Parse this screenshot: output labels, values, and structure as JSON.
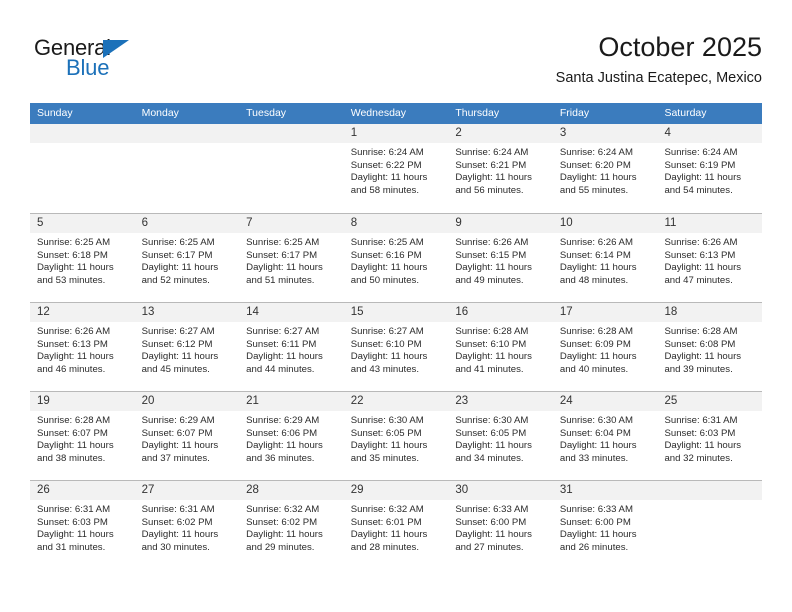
{
  "brand": {
    "name_part1": "General",
    "name_part2": "Blue",
    "accent_color": "#1c71b9",
    "triangle_icon": "brand-triangle-icon"
  },
  "header": {
    "title": "October 2025",
    "subtitle": "Santa Justina Ecatepec, Mexico"
  },
  "calendar": {
    "header_bg": "#3b7cbe",
    "daynum_bg": "#f2f2f2",
    "weekday_labels": [
      "Sunday",
      "Monday",
      "Tuesday",
      "Wednesday",
      "Thursday",
      "Friday",
      "Saturday"
    ],
    "weeks": [
      [
        {
          "day": "",
          "lines": []
        },
        {
          "day": "",
          "lines": []
        },
        {
          "day": "",
          "lines": []
        },
        {
          "day": "1",
          "lines": [
            "Sunrise: 6:24 AM",
            "Sunset: 6:22 PM",
            "Daylight: 11 hours",
            "and 58 minutes."
          ]
        },
        {
          "day": "2",
          "lines": [
            "Sunrise: 6:24 AM",
            "Sunset: 6:21 PM",
            "Daylight: 11 hours",
            "and 56 minutes."
          ]
        },
        {
          "day": "3",
          "lines": [
            "Sunrise: 6:24 AM",
            "Sunset: 6:20 PM",
            "Daylight: 11 hours",
            "and 55 minutes."
          ]
        },
        {
          "day": "4",
          "lines": [
            "Sunrise: 6:24 AM",
            "Sunset: 6:19 PM",
            "Daylight: 11 hours",
            "and 54 minutes."
          ]
        }
      ],
      [
        {
          "day": "5",
          "lines": [
            "Sunrise: 6:25 AM",
            "Sunset: 6:18 PM",
            "Daylight: 11 hours",
            "and 53 minutes."
          ]
        },
        {
          "day": "6",
          "lines": [
            "Sunrise: 6:25 AM",
            "Sunset: 6:17 PM",
            "Daylight: 11 hours",
            "and 52 minutes."
          ]
        },
        {
          "day": "7",
          "lines": [
            "Sunrise: 6:25 AM",
            "Sunset: 6:17 PM",
            "Daylight: 11 hours",
            "and 51 minutes."
          ]
        },
        {
          "day": "8",
          "lines": [
            "Sunrise: 6:25 AM",
            "Sunset: 6:16 PM",
            "Daylight: 11 hours",
            "and 50 minutes."
          ]
        },
        {
          "day": "9",
          "lines": [
            "Sunrise: 6:26 AM",
            "Sunset: 6:15 PM",
            "Daylight: 11 hours",
            "and 49 minutes."
          ]
        },
        {
          "day": "10",
          "lines": [
            "Sunrise: 6:26 AM",
            "Sunset: 6:14 PM",
            "Daylight: 11 hours",
            "and 48 minutes."
          ]
        },
        {
          "day": "11",
          "lines": [
            "Sunrise: 6:26 AM",
            "Sunset: 6:13 PM",
            "Daylight: 11 hours",
            "and 47 minutes."
          ]
        }
      ],
      [
        {
          "day": "12",
          "lines": [
            "Sunrise: 6:26 AM",
            "Sunset: 6:13 PM",
            "Daylight: 11 hours",
            "and 46 minutes."
          ]
        },
        {
          "day": "13",
          "lines": [
            "Sunrise: 6:27 AM",
            "Sunset: 6:12 PM",
            "Daylight: 11 hours",
            "and 45 minutes."
          ]
        },
        {
          "day": "14",
          "lines": [
            "Sunrise: 6:27 AM",
            "Sunset: 6:11 PM",
            "Daylight: 11 hours",
            "and 44 minutes."
          ]
        },
        {
          "day": "15",
          "lines": [
            "Sunrise: 6:27 AM",
            "Sunset: 6:10 PM",
            "Daylight: 11 hours",
            "and 43 minutes."
          ]
        },
        {
          "day": "16",
          "lines": [
            "Sunrise: 6:28 AM",
            "Sunset: 6:10 PM",
            "Daylight: 11 hours",
            "and 41 minutes."
          ]
        },
        {
          "day": "17",
          "lines": [
            "Sunrise: 6:28 AM",
            "Sunset: 6:09 PM",
            "Daylight: 11 hours",
            "and 40 minutes."
          ]
        },
        {
          "day": "18",
          "lines": [
            "Sunrise: 6:28 AM",
            "Sunset: 6:08 PM",
            "Daylight: 11 hours",
            "and 39 minutes."
          ]
        }
      ],
      [
        {
          "day": "19",
          "lines": [
            "Sunrise: 6:28 AM",
            "Sunset: 6:07 PM",
            "Daylight: 11 hours",
            "and 38 minutes."
          ]
        },
        {
          "day": "20",
          "lines": [
            "Sunrise: 6:29 AM",
            "Sunset: 6:07 PM",
            "Daylight: 11 hours",
            "and 37 minutes."
          ]
        },
        {
          "day": "21",
          "lines": [
            "Sunrise: 6:29 AM",
            "Sunset: 6:06 PM",
            "Daylight: 11 hours",
            "and 36 minutes."
          ]
        },
        {
          "day": "22",
          "lines": [
            "Sunrise: 6:30 AM",
            "Sunset: 6:05 PM",
            "Daylight: 11 hours",
            "and 35 minutes."
          ]
        },
        {
          "day": "23",
          "lines": [
            "Sunrise: 6:30 AM",
            "Sunset: 6:05 PM",
            "Daylight: 11 hours",
            "and 34 minutes."
          ]
        },
        {
          "day": "24",
          "lines": [
            "Sunrise: 6:30 AM",
            "Sunset: 6:04 PM",
            "Daylight: 11 hours",
            "and 33 minutes."
          ]
        },
        {
          "day": "25",
          "lines": [
            "Sunrise: 6:31 AM",
            "Sunset: 6:03 PM",
            "Daylight: 11 hours",
            "and 32 minutes."
          ]
        }
      ],
      [
        {
          "day": "26",
          "lines": [
            "Sunrise: 6:31 AM",
            "Sunset: 6:03 PM",
            "Daylight: 11 hours",
            "and 31 minutes."
          ]
        },
        {
          "day": "27",
          "lines": [
            "Sunrise: 6:31 AM",
            "Sunset: 6:02 PM",
            "Daylight: 11 hours",
            "and 30 minutes."
          ]
        },
        {
          "day": "28",
          "lines": [
            "Sunrise: 6:32 AM",
            "Sunset: 6:02 PM",
            "Daylight: 11 hours",
            "and 29 minutes."
          ]
        },
        {
          "day": "29",
          "lines": [
            "Sunrise: 6:32 AM",
            "Sunset: 6:01 PM",
            "Daylight: 11 hours",
            "and 28 minutes."
          ]
        },
        {
          "day": "30",
          "lines": [
            "Sunrise: 6:33 AM",
            "Sunset: 6:00 PM",
            "Daylight: 11 hours",
            "and 27 minutes."
          ]
        },
        {
          "day": "31",
          "lines": [
            "Sunrise: 6:33 AM",
            "Sunset: 6:00 PM",
            "Daylight: 11 hours",
            "and 26 minutes."
          ]
        },
        {
          "day": "",
          "lines": []
        }
      ]
    ]
  }
}
